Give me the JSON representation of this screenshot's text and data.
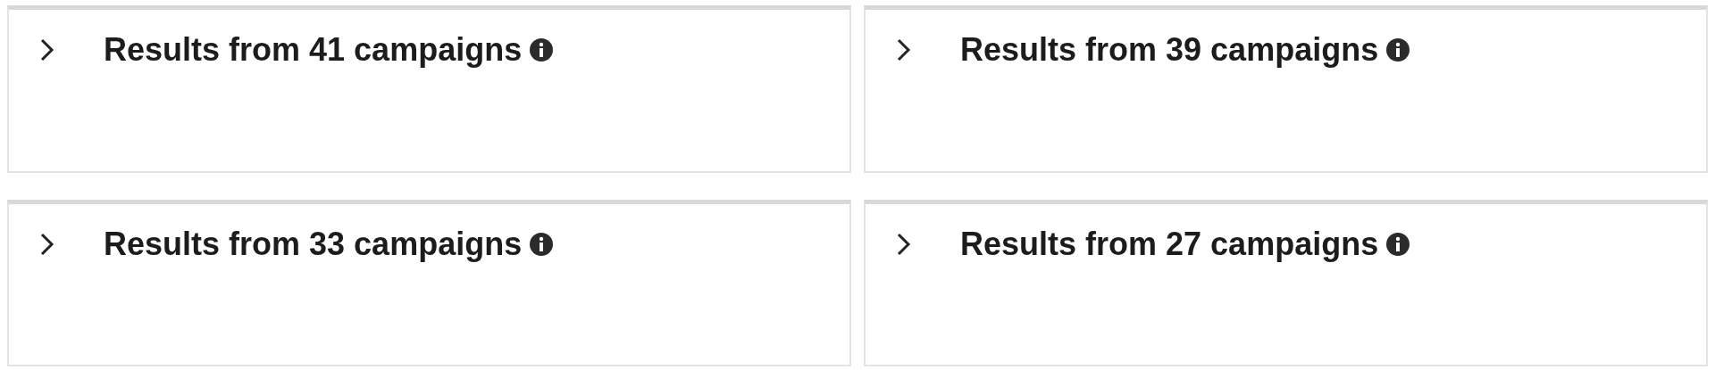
{
  "panels": [
    {
      "title": "Results from 41 campaigns",
      "expanded": false
    },
    {
      "title": "Results from 39 campaigns",
      "expanded": false
    },
    {
      "title": "Results from 33 campaigns",
      "expanded": false
    },
    {
      "title": "Results from 27 campaigns",
      "expanded": false
    }
  ]
}
